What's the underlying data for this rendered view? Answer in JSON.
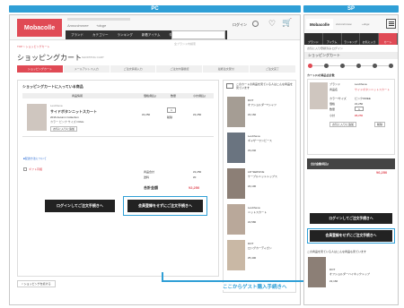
{
  "labels": {
    "pc": "PC",
    "sp": "SP"
  },
  "brand": {
    "logo": "Mobacolle",
    "accent": "#e04a55",
    "callout": "#2f9fd6"
  },
  "pc": {
    "nav": [
      "ブランド",
      "カテゴリー",
      "ランキング",
      "新着アイテム",
      "特集企画"
    ],
    "login": "ログイン",
    "search_placeholder": "全ブランド内検索",
    "breadcrumb": "TOP > ショッピングカート",
    "page_title": "ショッピングカート",
    "page_title_en": "SHOPPING CART",
    "steps": [
      "ショッピングカート",
      "メールアドレス入力",
      "ご注文情報入力",
      "ご注文内容確認",
      "最終注文受付",
      "ご注文完了"
    ],
    "cart_heading": "ショッピングカートに入っている商品",
    "table_headers": [
      "商品情報",
      "価格(税込)",
      "数量",
      "小計(税込)"
    ],
    "item": {
      "brand": "LesCheva",
      "name": "サイドボタンニットスカート",
      "collection": "2016 Autumn Collection",
      "variant": "カラー ピンク サイズ FREE",
      "fav_button": "お気に入りに追加",
      "price": "¥2,250",
      "qty": "1",
      "delete": "削除",
      "subtotal": "¥2,250"
    },
    "shipping_link": "■配送方法について",
    "gift_check": "ギフト同梱",
    "summary": [
      {
        "label": "商品合計",
        "value": "¥2,250"
      },
      {
        "label": "送料",
        "value": "¥0"
      }
    ],
    "total_label": "合計金額",
    "total_value": "¥2,250",
    "login_button": "ログインしてご注文手続きへ",
    "guest_button": "会員登録をせずにご注文手続きへ",
    "continue_link": "< ショッピングを続ける",
    "rec_heading": "このカートの商品を見ている人はこんな商品を見ています",
    "rec_items": [
      {
        "brand": "DOT",
        "name": "オフショルダーTシャツ",
        "price": "¥2,160"
      },
      {
        "brand": "LesCheva",
        "name": "ギャザーワンピース",
        "price": "¥3,240"
      },
      {
        "brand": "LIP SERVICE",
        "name": "ケーブルニットトップス",
        "price": "¥4,100"
      },
      {
        "brand": "LesCheva",
        "name": "ニットスカート",
        "price": "¥2,580"
      },
      {
        "brand": "DOT",
        "name": "ロングカーディガン",
        "price": "¥5,400"
      }
    ]
  },
  "sp": {
    "nav": [
      "ブランド",
      "アイテム",
      "ランキング",
      "お気に入り",
      "カート"
    ],
    "menu": "MENU",
    "login_text": "お気に入り登録済み ログイン",
    "title": "ショッピングカート",
    "cart_heading": "カート(1)の商品合計数",
    "item": {
      "brand_label": "ブランド",
      "brand": "LesCheva",
      "name_label": "商品名",
      "name": "サイドボタンニットスカート",
      "variant_label": "カラー/サイズ",
      "variant": "ピンク/FREE",
      "price_label": "価格",
      "price": "¥2,250",
      "qty_label": "数量",
      "qty": "1",
      "subtotal_label": "小計",
      "subtotal": "¥6,250",
      "fav_button": "お気に入りに追加",
      "delete_button": "削除"
    },
    "total_label": "合計金額(税込)",
    "total_value": "¥6,250",
    "login_button": "ログインしてご注文手続きへ",
    "guest_button": "会員登録をせずにご注文手続きへ",
    "rec_heading": "この商品を見ている人はこんな商品も見ています",
    "rec_item": {
      "brand": "DOT",
      "name": "オフショルダーハイネックトップ",
      "price": "¥2,160"
    }
  },
  "annotation": "ここからゲスト購入手続きへ"
}
